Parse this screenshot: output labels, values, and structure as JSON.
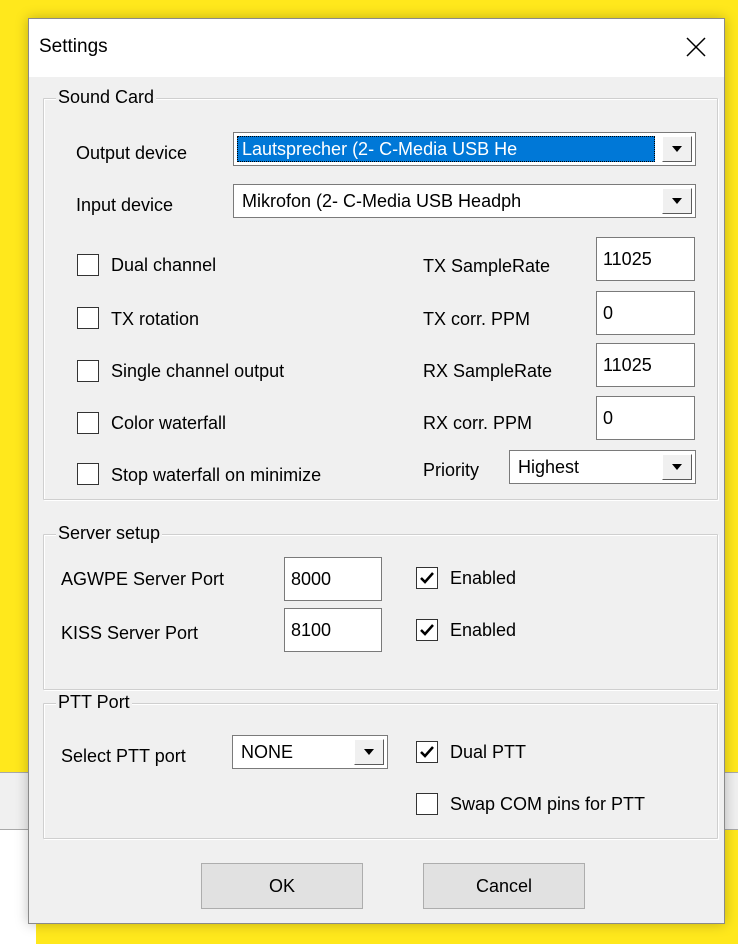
{
  "dialog": {
    "title": "Settings"
  },
  "sound_card": {
    "legend": "Sound Card",
    "output_label": "Output device",
    "output_value": "Lautsprecher (2- C-Media USB He",
    "input_label": "Input device",
    "input_value": "Mikrofon (2- C-Media USB Headph",
    "dual_channel": {
      "label": "Dual channel",
      "checked": false
    },
    "tx_rotation": {
      "label": "TX rotation",
      "checked": false
    },
    "single_channel": {
      "label": "Single channel output",
      "checked": false
    },
    "color_waterfall": {
      "label": "Color waterfall",
      "checked": false
    },
    "stop_waterfall": {
      "label": "Stop waterfall on minimize",
      "checked": false
    },
    "tx_samplerate_label": "TX SampleRate",
    "tx_samplerate_value": "11025",
    "tx_corr_label": "TX corr. PPM",
    "tx_corr_value": "0",
    "rx_samplerate_label": "RX SampleRate",
    "rx_samplerate_value": "11025",
    "rx_corr_label": "RX corr. PPM",
    "rx_corr_value": "0",
    "priority_label": "Priority",
    "priority_value": "Highest"
  },
  "server": {
    "legend": "Server setup",
    "agwpe_label": "AGWPE Server Port",
    "agwpe_value": "8000",
    "agwpe_enabled": {
      "label": "Enabled",
      "checked": true
    },
    "kiss_label": "KISS Server Port",
    "kiss_value": "8100",
    "kiss_enabled": {
      "label": "Enabled",
      "checked": true
    }
  },
  "ptt": {
    "legend": "PTT Port",
    "select_label": "Select PTT port",
    "select_value": "NONE",
    "dual_ptt": {
      "label": "Dual PTT",
      "checked": true
    },
    "swap_com": {
      "label": "Swap COM pins for PTT",
      "checked": false
    }
  },
  "buttons": {
    "ok": "OK",
    "cancel": "Cancel"
  },
  "colors": {
    "background": "#ffe81c",
    "dialog": "#f0f0f0",
    "selection": "#0078d7"
  }
}
